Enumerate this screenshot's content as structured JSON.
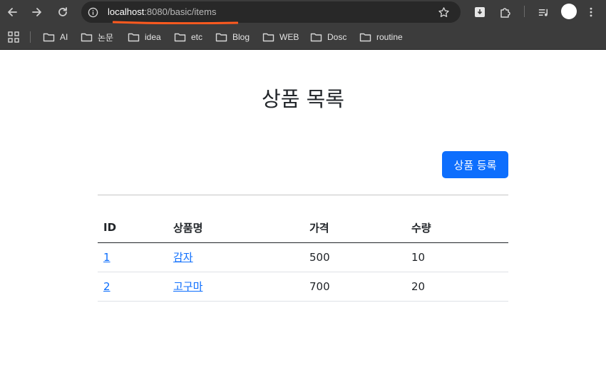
{
  "browser": {
    "url_host": "localhost",
    "url_path": ":8080/basic/items",
    "accent": "#ff5a1f",
    "bookmarks": [
      {
        "label": "AI"
      },
      {
        "label": "논문"
      },
      {
        "label": "idea"
      },
      {
        "label": "etc"
      },
      {
        "label": "Blog"
      },
      {
        "label": "WEB"
      },
      {
        "label": "Dosc"
      },
      {
        "label": "routine"
      }
    ]
  },
  "page": {
    "title": "상품 목록",
    "add_button_label": "상품 등록",
    "table": {
      "headers": {
        "id": "ID",
        "name": "상품명",
        "price": "가격",
        "quantity": "수량"
      },
      "rows": [
        {
          "id": "1",
          "name": "감자",
          "price": "500",
          "quantity": "10"
        },
        {
          "id": "2",
          "name": "고구마",
          "price": "700",
          "quantity": "20"
        }
      ]
    },
    "colors": {
      "primary": "#0d6efd",
      "text": "#212529",
      "chrome": "#3c3c3c"
    }
  }
}
